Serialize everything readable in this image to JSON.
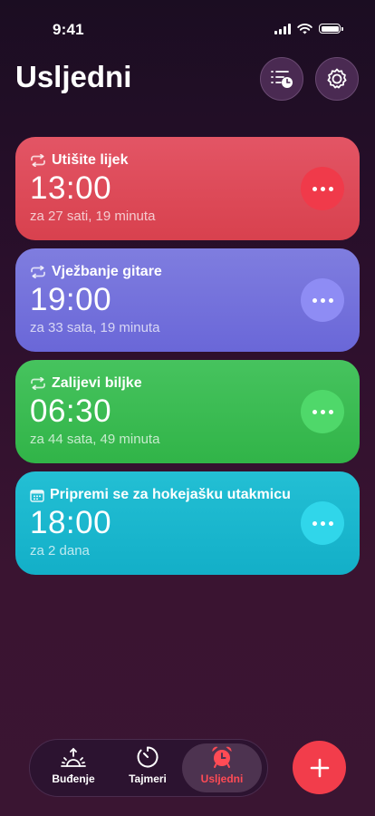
{
  "status_bar": {
    "time": "9:41"
  },
  "header": {
    "title": "Usljedni"
  },
  "reminders": [
    {
      "title": "Utišite lijek",
      "time": "13:00",
      "subtitle": "za 27 sati, 19 minuta",
      "icon": "repeat-icon",
      "color": "#d8414e"
    },
    {
      "title": "Vježbanje gitare",
      "time": "19:00",
      "subtitle": "za 33 sata, 19 minuta",
      "icon": "repeat-icon",
      "color": "#6a67d8"
    },
    {
      "title": "Zalijevi biljke",
      "time": "06:30",
      "subtitle": "za 44 sata, 49 minuta",
      "icon": "repeat-icon",
      "color": "#31b448"
    },
    {
      "title": "Pripremi se za hokejašku utakmicu",
      "time": "18:00",
      "subtitle": "za 2 dana",
      "icon": "calendar-icon",
      "color": "#13afc8"
    }
  ],
  "tabs": [
    {
      "label": "Buđenje",
      "icon": "sunrise-icon"
    },
    {
      "label": "Tajmeri",
      "icon": "timer-icon"
    },
    {
      "label": "Usljedni",
      "icon": "alarm-clock-icon",
      "active": true
    }
  ],
  "colors": {
    "accent": "#f23d4b",
    "background": "#2b0f2c"
  }
}
